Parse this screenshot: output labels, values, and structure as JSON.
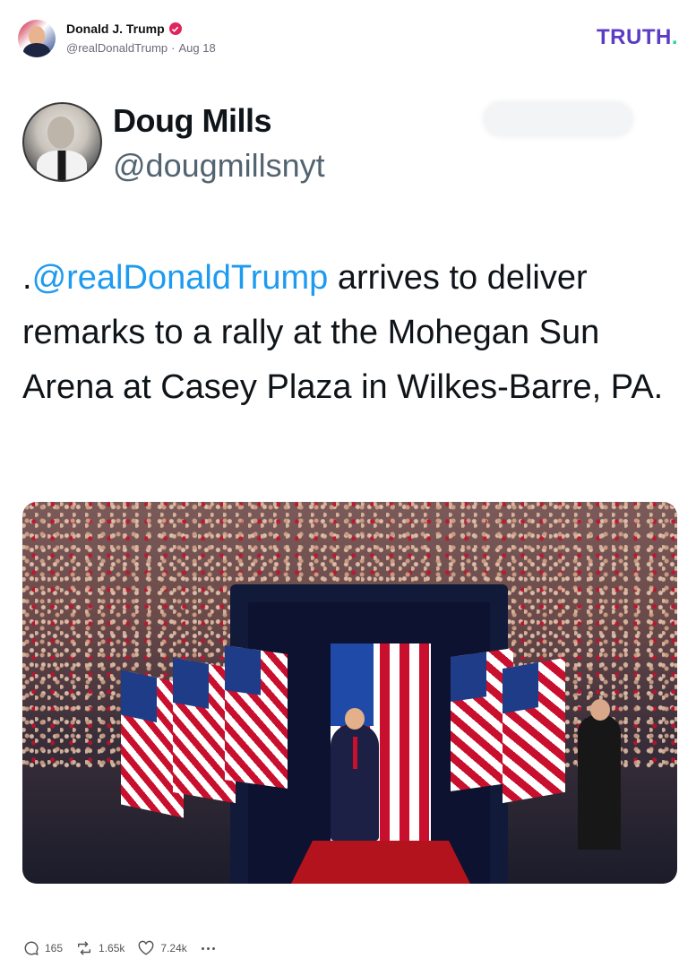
{
  "post": {
    "author_name": "Donald J. Trump",
    "handle": "@realDonaldTrump",
    "separator": "·",
    "date": "Aug 18",
    "brand": "TRUTH",
    "brand_dot": "."
  },
  "embedded_tweet": {
    "name": "Doug Mills",
    "handle": "@dougmillsnyt",
    "text_prefix": ".",
    "mention": "@realDonaldTrump",
    "text_body": " arrives to deliver remarks to a rally at the Mohegan Sun Arena at Casey Plaza in Wilkes-Barre, PA."
  },
  "actions": {
    "replies": "165",
    "retruths": "1.65k",
    "likes": "7.24k"
  },
  "icons": {
    "verified": "verified-badge-icon",
    "reply": "speech-bubble-icon",
    "retruth": "repost-arrows-icon",
    "like": "heart-icon",
    "more": "ellipsis-icon"
  },
  "colors": {
    "brand": "#5b3cc4",
    "brand_dot": "#2ad4a0",
    "verified": "#e0245e",
    "mention": "#1d9bf0"
  }
}
